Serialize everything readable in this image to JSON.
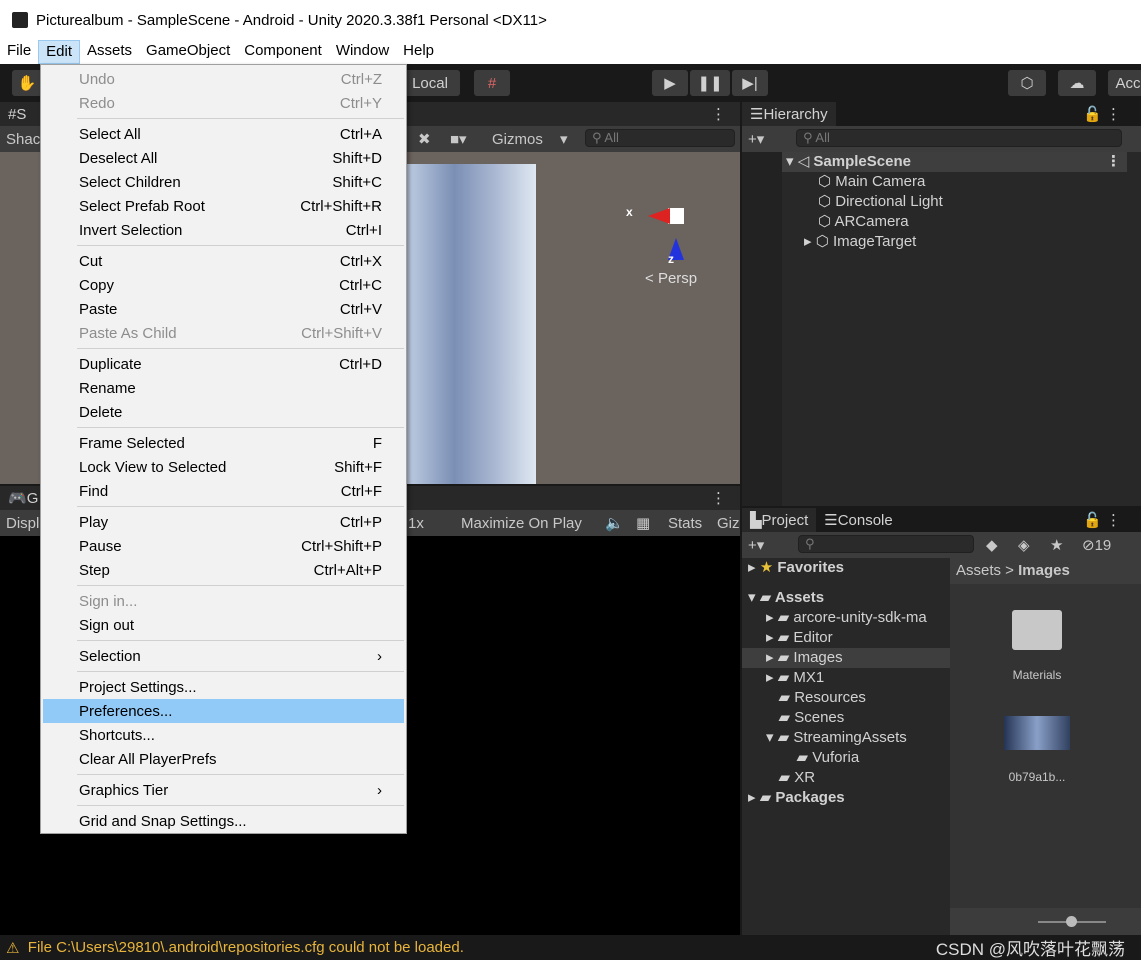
{
  "window": {
    "title": "Picturealbum - SampleScene - Android - Unity 2020.3.38f1 Personal <DX11>"
  },
  "menubar": [
    "File",
    "Edit",
    "Assets",
    "GameObject",
    "Component",
    "Window",
    "Help"
  ],
  "toolbar": {
    "pivot_label": "Local",
    "account_label": "Acc"
  },
  "scene": {
    "tab_label": "S",
    "shading_label": "Shac",
    "gizmos_label": "Gizmos",
    "search_placeholder": "All",
    "axis_x": "x",
    "axis_z": "z",
    "persp_label": "Persp"
  },
  "game": {
    "tab_label": "G",
    "display_label": "Displ",
    "scale_label": "1x",
    "maximize_label": "Maximize On Play",
    "stats_label": "Stats",
    "gizmos_label": "Giz"
  },
  "hierarchy": {
    "tab_label": "Hierarchy",
    "search_placeholder": "All",
    "scene_name": "SampleScene",
    "items": [
      "Main Camera",
      "Directional Light",
      "ARCamera",
      "ImageTarget"
    ]
  },
  "project": {
    "tab_label": "Project",
    "console_label": "Console",
    "hidden_count": "19",
    "favorites": "Favorites",
    "breadcrumb": [
      "Assets",
      "Images"
    ],
    "tree": [
      {
        "label": "Assets",
        "depth": 0,
        "bold": true,
        "arrow": "down"
      },
      {
        "label": "arcore-unity-sdk-ma",
        "depth": 1,
        "arrow": "right"
      },
      {
        "label": "Editor",
        "depth": 1,
        "arrow": "right"
      },
      {
        "label": "Images",
        "depth": 1,
        "arrow": "right",
        "selected": true
      },
      {
        "label": "MX1",
        "depth": 1,
        "arrow": "right"
      },
      {
        "label": "Resources",
        "depth": 1
      },
      {
        "label": "Scenes",
        "depth": 1
      },
      {
        "label": "StreamingAssets",
        "depth": 1,
        "arrow": "down"
      },
      {
        "label": "Vuforia",
        "depth": 2
      },
      {
        "label": "XR",
        "depth": 1
      },
      {
        "label": "Packages",
        "depth": 0,
        "bold": true,
        "arrow": "right"
      }
    ],
    "assets": [
      {
        "name": "Materials",
        "type": "folder"
      },
      {
        "name": "0b79a1b...",
        "type": "image"
      }
    ]
  },
  "edit_menu": [
    [
      {
        "label": "Undo",
        "shortcut": "Ctrl+Z",
        "disabled": true
      },
      {
        "label": "Redo",
        "shortcut": "Ctrl+Y",
        "disabled": true
      }
    ],
    [
      {
        "label": "Select All",
        "shortcut": "Ctrl+A"
      },
      {
        "label": "Deselect All",
        "shortcut": "Shift+D"
      },
      {
        "label": "Select Children",
        "shortcut": "Shift+C"
      },
      {
        "label": "Select Prefab Root",
        "shortcut": "Ctrl+Shift+R"
      },
      {
        "label": "Invert Selection",
        "shortcut": "Ctrl+I"
      }
    ],
    [
      {
        "label": "Cut",
        "shortcut": "Ctrl+X"
      },
      {
        "label": "Copy",
        "shortcut": "Ctrl+C"
      },
      {
        "label": "Paste",
        "shortcut": "Ctrl+V"
      },
      {
        "label": "Paste As Child",
        "shortcut": "Ctrl+Shift+V",
        "disabled": true
      }
    ],
    [
      {
        "label": "Duplicate",
        "shortcut": "Ctrl+D"
      },
      {
        "label": "Rename",
        "shortcut": ""
      },
      {
        "label": "Delete",
        "shortcut": ""
      }
    ],
    [
      {
        "label": "Frame Selected",
        "shortcut": "F"
      },
      {
        "label": "Lock View to Selected",
        "shortcut": "Shift+F"
      },
      {
        "label": "Find",
        "shortcut": "Ctrl+F"
      }
    ],
    [
      {
        "label": "Play",
        "shortcut": "Ctrl+P"
      },
      {
        "label": "Pause",
        "shortcut": "Ctrl+Shift+P"
      },
      {
        "label": "Step",
        "shortcut": "Ctrl+Alt+P"
      }
    ],
    [
      {
        "label": "Sign in...",
        "shortcut": "",
        "disabled": true
      },
      {
        "label": "Sign out",
        "shortcut": ""
      }
    ],
    [
      {
        "label": "Selection",
        "shortcut": "›"
      }
    ],
    [
      {
        "label": "Project Settings...",
        "shortcut": ""
      },
      {
        "label": "Preferences...",
        "shortcut": "",
        "highlighted": true
      },
      {
        "label": "Shortcuts...",
        "shortcut": ""
      },
      {
        "label": "Clear All PlayerPrefs",
        "shortcut": ""
      }
    ],
    [
      {
        "label": "Graphics Tier",
        "shortcut": "›"
      }
    ],
    [
      {
        "label": "Grid and Snap Settings...",
        "shortcut": ""
      }
    ]
  ],
  "status": {
    "message": "File C:\\Users\\29810\\.android\\repositories.cfg could not be loaded.",
    "watermark": "CSDN @风吹落叶花飘荡"
  }
}
